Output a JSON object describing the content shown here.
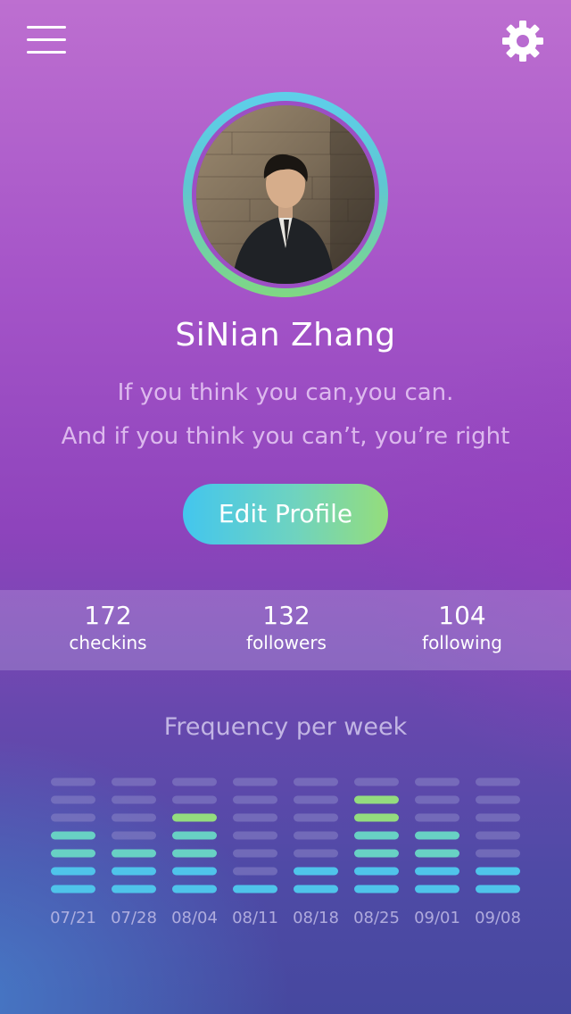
{
  "header": {
    "menu_icon": "hamburger-menu-icon",
    "settings_icon": "gear-icon"
  },
  "profile": {
    "name": "SiNian Zhang",
    "quote_line1": "If you think you can,you can.",
    "quote_line2": "And if you think you can’t, you’re right",
    "edit_button_label": "Edit Profile"
  },
  "stats": [
    {
      "value": "172",
      "label": "checkins"
    },
    {
      "value": "132",
      "label": "followers"
    },
    {
      "value": "104",
      "label": "following"
    }
  ],
  "colors": {
    "accent_blue": "#4fc4ea",
    "accent_teal": "#68d1c4",
    "accent_green": "#94dc7e",
    "inactive_bar": "#8a85c6"
  },
  "chart_data": {
    "type": "bar",
    "title": "Frequency per week",
    "categories": [
      "07/21",
      "07/28",
      "08/04",
      "08/11",
      "08/18",
      "08/25",
      "09/01",
      "09/08"
    ],
    "values": [
      4,
      3,
      5,
      1,
      2,
      6,
      4,
      2
    ],
    "ylim": [
      0,
      7
    ]
  }
}
